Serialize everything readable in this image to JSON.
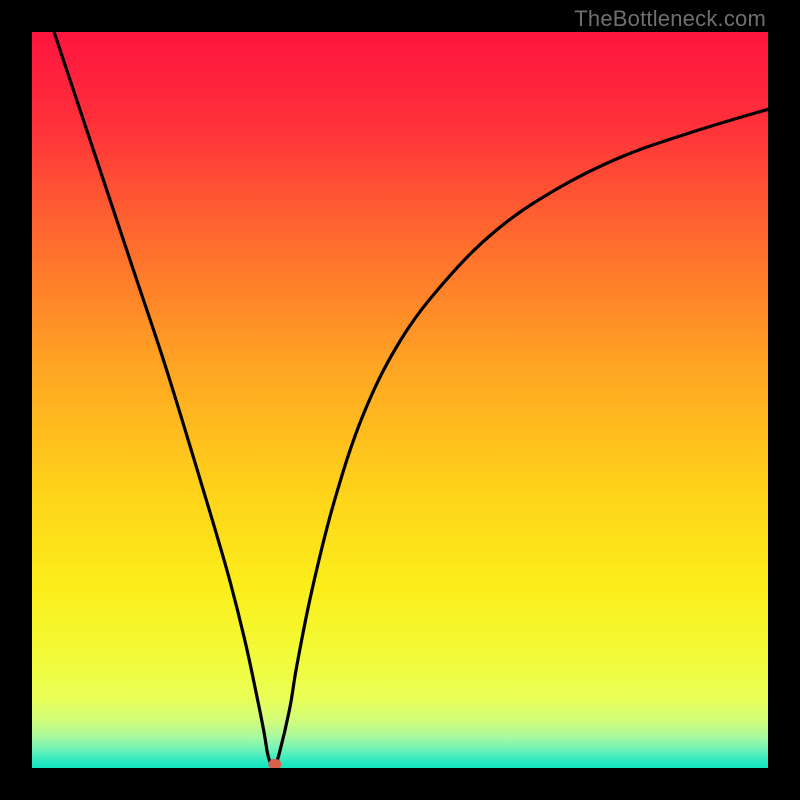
{
  "watermark": "TheBottleneck.com",
  "chart_data": {
    "type": "line",
    "title": "",
    "xlabel": "",
    "ylabel": "",
    "xlim": [
      0,
      100
    ],
    "ylim": [
      0,
      100
    ],
    "grid": false,
    "series": [
      {
        "name": "curve",
        "x": [
          3,
          6,
          10,
          14,
          18,
          22,
          25,
          27,
          29,
          30.5,
          31.5,
          32,
          32.5,
          33,
          33.6,
          35,
          36,
          38,
          41,
          45,
          50,
          56,
          63,
          71,
          80,
          90,
          100
        ],
        "y": [
          100,
          91,
          79,
          67,
          55,
          42,
          32,
          25,
          17,
          10,
          5,
          2,
          0.5,
          0.5,
          2,
          8,
          14,
          24,
          36,
          48,
          58,
          66,
          73,
          78.5,
          83,
          86.5,
          89.5
        ]
      }
    ],
    "marker": {
      "x": 33,
      "y": 0.5
    },
    "gradient_stops": [
      {
        "offset": 0.0,
        "color": "#ff153f"
      },
      {
        "offset": 0.12,
        "color": "#ff2f3a"
      },
      {
        "offset": 0.28,
        "color": "#ff6a2e"
      },
      {
        "offset": 0.45,
        "color": "#ffa323"
      },
      {
        "offset": 0.62,
        "color": "#ffd21a"
      },
      {
        "offset": 0.76,
        "color": "#fbef1b"
      },
      {
        "offset": 0.85,
        "color": "#f2fb3a"
      },
      {
        "offset": 0.905,
        "color": "#e9fe56"
      },
      {
        "offset": 0.935,
        "color": "#d2fd7a"
      },
      {
        "offset": 0.958,
        "color": "#a8f99f"
      },
      {
        "offset": 0.975,
        "color": "#6ef2b8"
      },
      {
        "offset": 0.99,
        "color": "#2de9c1"
      },
      {
        "offset": 1.0,
        "color": "#12e6bd"
      }
    ]
  }
}
